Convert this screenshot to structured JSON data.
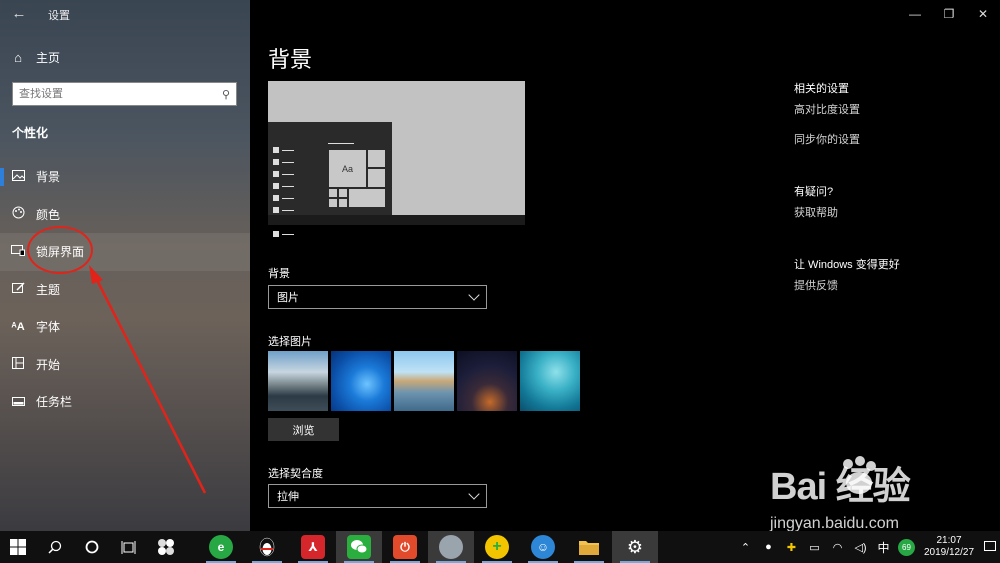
{
  "window": {
    "app_title": "设置",
    "back_icon": "←",
    "controls": {
      "minimize": "—",
      "maximize": "❐",
      "close": "✕"
    }
  },
  "sidebar": {
    "home_label": "主页",
    "search_placeholder": "查找设置",
    "section_title": "个性化",
    "items": [
      {
        "label": "背景",
        "icon": "picture-icon"
      },
      {
        "label": "颜色",
        "icon": "palette-icon"
      },
      {
        "label": "锁屏界面",
        "icon": "lock-screen-icon"
      },
      {
        "label": "主题",
        "icon": "theme-icon"
      },
      {
        "label": "字体",
        "icon": "font-icon"
      },
      {
        "label": "开始",
        "icon": "start-icon"
      },
      {
        "label": "任务栏",
        "icon": "taskbar-icon"
      }
    ]
  },
  "main": {
    "page_title": "背景",
    "preview_sample_text": "Aa",
    "background_label": "背景",
    "background_value": "图片",
    "choose_picture_label": "选择图片",
    "browse_label": "浏览",
    "fit_label": "选择契合度",
    "fit_value": "拉伸"
  },
  "related": {
    "title": "相关的设置",
    "links": [
      "高对比度设置",
      "同步你的设置"
    ],
    "question_title": "有疑问?",
    "help_link": "获取帮助",
    "improve_title": "让 Windows 变得更好",
    "feedback_link": "提供反馈"
  },
  "watermark": {
    "logo": "Bai  经验",
    "url": "jingyan.baidu.com"
  },
  "taskbar": {
    "tray": {
      "ime": "中",
      "badge": "69",
      "time": "21:07",
      "date": "2019/12/27"
    }
  },
  "colors": {
    "accent": "#2d7fd9",
    "annotation": "#e2231a"
  }
}
